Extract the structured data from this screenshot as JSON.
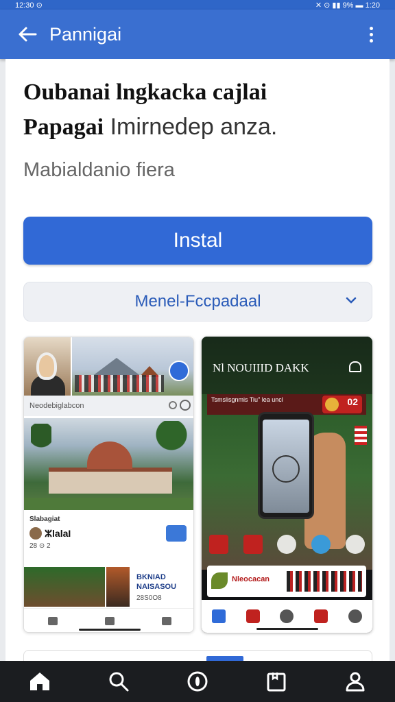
{
  "statusbar": {
    "left": "12:30 ⊙",
    "right": "✕ ⊙ ▮▮ 9% ▬ 1:20"
  },
  "appbar": {
    "title": "Pannigai"
  },
  "heading": {
    "line1": "Oubanai lngkacka cajlai",
    "line2_bold": "Papagai",
    "line2_rest": " Imirnedep anza.",
    "subtitle": "Mabialdanio fiera"
  },
  "install_button": "Instal",
  "dropdown": {
    "label": "Menel-Fccpadaal"
  },
  "screenshot_left": {
    "search_placeholder": "Neodebiglabcon",
    "info_caption": "Slabagiat",
    "info_row": "ⵣlalaI",
    "info_count": "28 ⊙ 2",
    "strip_title_1": "BKNIAD",
    "strip_title_2": "NAISASOU",
    "strip_sub": "28S0O8"
  },
  "screenshot_right": {
    "title": "Nl  NOUIIID DAKK",
    "banner": "Tsmslisgnmis\nTiu\" lea uncl",
    "badge": "02",
    "strip_text": "Nleocacan"
  },
  "colors": {
    "primary": "#3169d6",
    "appbar": "#3a6fd0",
    "nav_dark": "#1b1d20"
  },
  "bottom_nav": [
    "home-icon",
    "search-icon",
    "discover-icon",
    "library-icon",
    "profile-icon"
  ]
}
